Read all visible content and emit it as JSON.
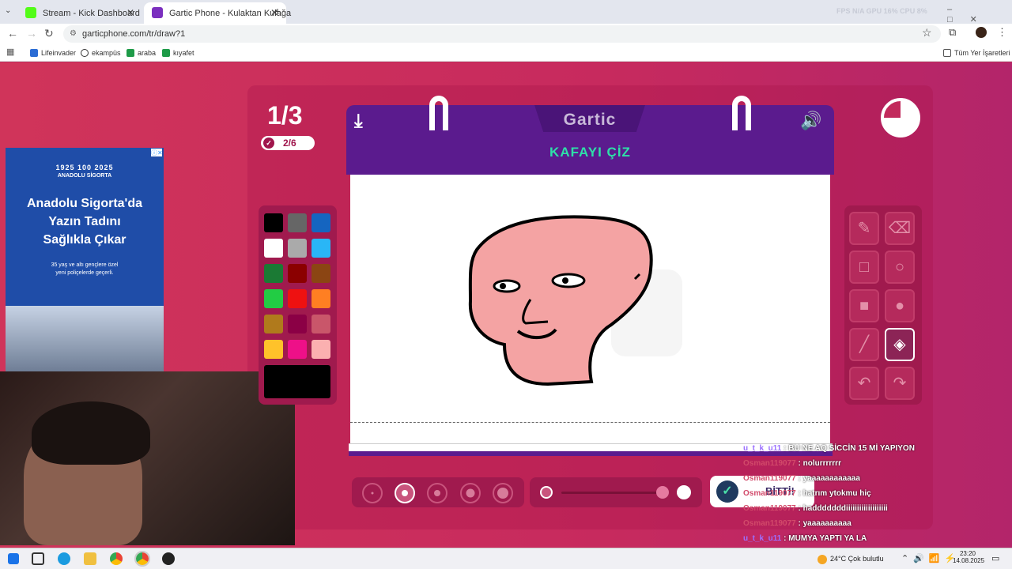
{
  "browser": {
    "tabs": [
      {
        "title": "Stream - Kick Dashboard",
        "favicon_color": "#53fc18"
      },
      {
        "title": "Gartic Phone - Kulaktan Kulağa",
        "favicon_color": "#7b2fbf"
      }
    ],
    "url": "garticphone.com/tr/draw?1",
    "bookmarks": [
      "Lifeinvader",
      "ekampüs",
      "araba",
      "kıyafet"
    ],
    "all_bookmarks": "Tüm Yer İşaretleri",
    "overlay_stats": "FPS N/A   GPU 16%   CPU 8%"
  },
  "ad": {
    "logo_years": "1925  100  2025",
    "brand": "ANADOLU SİGORTA",
    "headline_1": "Anadolu Sigorta'da",
    "headline_2": "Yazın Tadını",
    "headline_3": "Sağlıkla Çıkar",
    "sub_1": "35 yaş ve altı gençlere özel",
    "sub_2": "yeni poliçelerde geçerli."
  },
  "game": {
    "round": "1/3",
    "players_done": "2/6",
    "brand": "Gartic",
    "task_title": "KAFAYI ÇİZ",
    "done_button": "BİTTİ!",
    "palette_colors": [
      "#000000",
      "#666666",
      "#1565c0",
      "#ffffff",
      "#aaaaaa",
      "#29b6f6",
      "#1b7a34",
      "#8b0000",
      "#8b4513",
      "#22cc44",
      "#ee1111",
      "#ff7f22",
      "#b07a1c",
      "#8b0045",
      "#c9566a",
      "#ffc22a",
      "#ee1088",
      "#fbb0b0"
    ],
    "selected_color": "#000000",
    "tools": [
      "pencil-icon",
      "eraser-icon",
      "rectangle-icon",
      "ellipse-icon",
      "filled-rect-icon",
      "filled-ellipse-icon",
      "line-icon",
      "fill-bucket-icon",
      "undo-icon",
      "redo-icon"
    ],
    "selected_tool": "fill-bucket-icon",
    "brush_sizes": 5,
    "selected_brush": 2
  },
  "chat": [
    {
      "user": "u_t_k_u11",
      "msg": "BU NE AQ SİCCİN 15 Mİ YAPIYON",
      "style": "u"
    },
    {
      "user": "Osman119077",
      "msg": "nolurrrrrrr",
      "style": "o"
    },
    {
      "user": "Osman119077",
      "msg": "yaaaaaaaaaaaa",
      "style": "o"
    },
    {
      "user": "Osman119077",
      "msg": "hatrım ytokmu hiç",
      "style": "o"
    },
    {
      "user": "Osman119077",
      "msg": "hadddddddiiiiiiiiiiiiiiiiiii",
      "style": "o"
    },
    {
      "user": "Osman119077",
      "msg": "yaaaaaaaaaa",
      "style": "o"
    },
    {
      "user": "u_t_k_u11",
      "msg": "MUMYA YAPTI YA LA",
      "style": "u"
    }
  ],
  "taskbar": {
    "weather": "24°C  Çok bulutlu",
    "time": "23:20",
    "date": "14.08.2025"
  }
}
